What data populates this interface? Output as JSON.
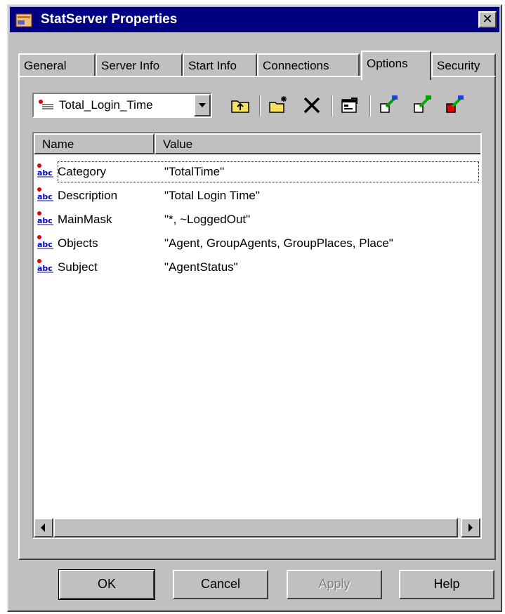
{
  "window": {
    "title": "StatServer Properties",
    "close_label": "✕"
  },
  "tabs": [
    {
      "label": "General"
    },
    {
      "label": "Server Info"
    },
    {
      "label": "Start Info"
    },
    {
      "label": "Connections"
    },
    {
      "label": "Options",
      "active": true
    },
    {
      "label": "Security"
    }
  ],
  "toolbar": {
    "section_value": "Total_Login_Time",
    "buttons": [
      "up-folder-icon",
      "new-option-icon",
      "delete-icon",
      "properties-icon",
      "export-icon",
      "import-icon",
      "sync-icon"
    ]
  },
  "list": {
    "columns": [
      "Name",
      "Value"
    ],
    "rows": [
      {
        "name": "Category",
        "value": "\"TotalTime\""
      },
      {
        "name": "Description",
        "value": "\"Total Login Time\""
      },
      {
        "name": "MainMask",
        "value": "\"*, ~LoggedOut\""
      },
      {
        "name": "Objects",
        "value": "\"Agent, GroupAgents, GroupPlaces, Place\""
      },
      {
        "name": "Subject",
        "value": "\"AgentStatus\""
      }
    ]
  },
  "buttons": {
    "ok": "OK",
    "cancel": "Cancel",
    "apply": "Apply",
    "help": "Help"
  },
  "colors": {
    "titlebar": "#000080",
    "face": "#c0c0c0"
  }
}
